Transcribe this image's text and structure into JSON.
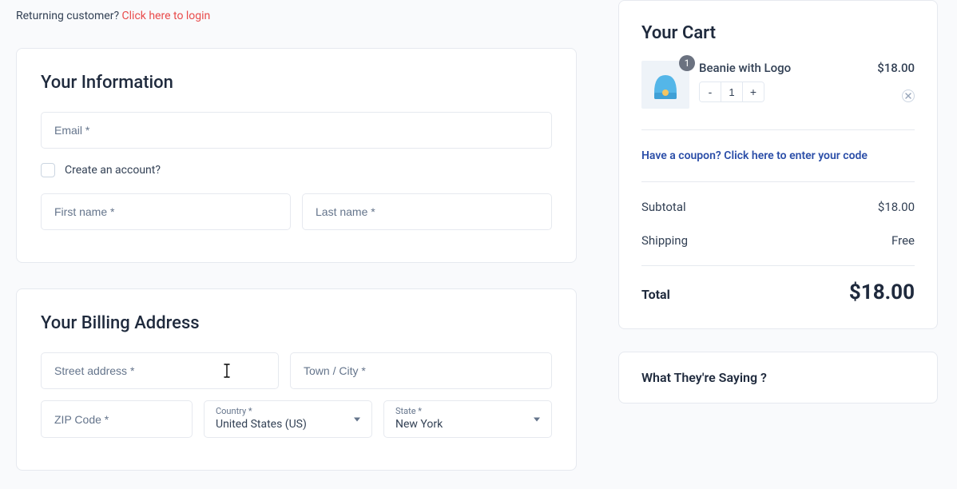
{
  "returning": {
    "prompt": "Returning customer? ",
    "link": "Click here to login"
  },
  "info": {
    "heading": "Your Information",
    "email_ph": "Email *",
    "create_account_label": "Create an account?",
    "first_name_ph": "First name *",
    "last_name_ph": "Last name *"
  },
  "billing": {
    "heading": "Your Billing Address",
    "street_ph": "Street address *",
    "town_ph": "Town / City *",
    "zip_ph": "ZIP Code *",
    "country_label": "Country *",
    "country_value": "United States (US)",
    "state_label": "State *",
    "state_value": "New York"
  },
  "cart": {
    "heading": "Your Cart",
    "items": [
      {
        "name": "Beanie with Logo",
        "qty": "1",
        "badge": "1",
        "price": "$18.00"
      }
    ],
    "coupon_prompt": "Have a coupon? Click here to enter your code",
    "subtotal_label": "Subtotal",
    "subtotal_value": "$18.00",
    "shipping_label": "Shipping",
    "shipping_value": "Free",
    "total_label": "Total",
    "total_value": "$18.00"
  },
  "testimonials": {
    "heading": "What They're Saying ?"
  }
}
